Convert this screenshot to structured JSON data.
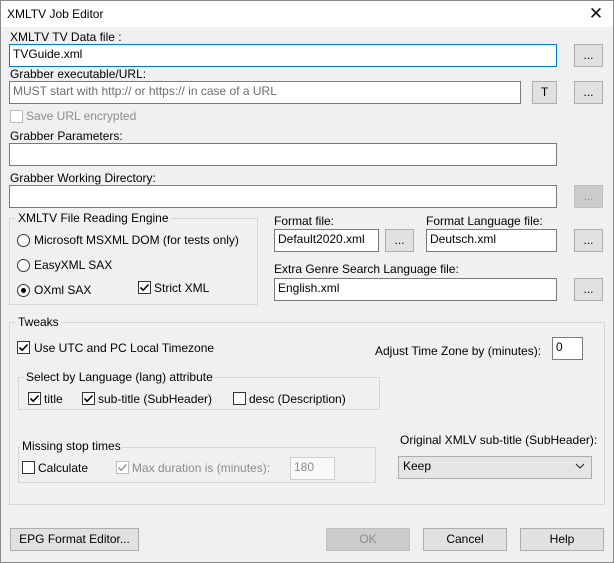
{
  "window": {
    "title": "XMLTV Job Editor",
    "close_glyph": "✕"
  },
  "data_file": {
    "label": "XMLTV TV Data file :",
    "value": "TVGuide.xml",
    "browse": "..."
  },
  "grabber": {
    "label": "Grabber executable/URL:",
    "placeholder": "MUST start with http:// or https:// in case of a URL",
    "t_button": "T",
    "browse": "..."
  },
  "save_url": {
    "label": "Save URL encrypted",
    "checked": false
  },
  "grabber_params": {
    "label": "Grabber Parameters:",
    "value": ""
  },
  "grabber_dir": {
    "label": "Grabber Working Directory:",
    "value": "",
    "browse": "..."
  },
  "engine": {
    "title": "XMLTV File Reading Engine",
    "options": [
      "Microsoft MSXML DOM (for tests only)",
      "EasyXML SAX",
      "OXml SAX"
    ],
    "selected": "OXml SAX",
    "strict": {
      "label": "Strict XML",
      "checked": true
    }
  },
  "format_file": {
    "label": "Format file:",
    "value": "Default2020.xml",
    "browse": "..."
  },
  "format_lang": {
    "label": "Format Language file:",
    "value": "Deutsch.xml",
    "browse": "..."
  },
  "genre_lang": {
    "label": "Extra Genre Search Language file:",
    "value": "English.xml",
    "browse": "..."
  },
  "tweaks": {
    "title": "Tweaks",
    "utc": {
      "label": "Use UTC and PC Local  Timezone",
      "checked": true
    },
    "adjust_tz": {
      "label": "Adjust Time Zone by (minutes):",
      "value": "0"
    },
    "lang_group": {
      "title": "Select by Language (lang) attribute",
      "title_cb": {
        "label": "title",
        "checked": true
      },
      "subtitle_cb": {
        "label": "sub-title (SubHeader)",
        "checked": true
      },
      "desc_cb": {
        "label": "desc (Description)",
        "checked": false
      }
    },
    "missing": {
      "title": "Missing stop times",
      "calculate": {
        "label": "Calculate",
        "checked": false
      },
      "max_duration": {
        "label": "Max duration is (minutes):",
        "checked": true,
        "value": "180"
      }
    },
    "orig_subtitle": {
      "label": "Original XMLV sub-title (SubHeader):",
      "selected": "Keep"
    }
  },
  "buttons": {
    "epg": "EPG Format Editor...",
    "ok": "OK",
    "cancel": "Cancel",
    "help": "Help"
  },
  "icons": {
    "check": "check-icon",
    "dropdown": "chevron-down-icon",
    "close": "close-icon"
  }
}
